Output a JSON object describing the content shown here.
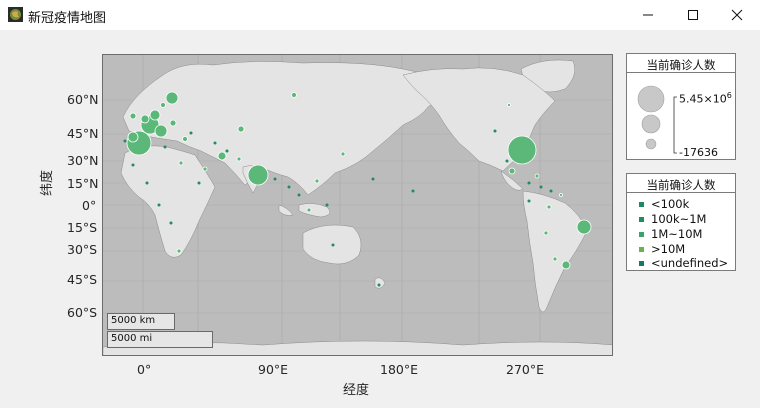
{
  "window": {
    "title": "新冠疫情地图",
    "icon": "globe-icon",
    "controls": [
      "minimize-icon",
      "maximize-icon",
      "close-icon"
    ]
  },
  "axes": {
    "yticks": [
      "60°N",
      "45°N",
      "30°N",
      "15°N",
      "0°",
      "15°S",
      "30°S",
      "45°S",
      "60°S"
    ],
    "xticks": [
      "0°",
      "90°E",
      "180°E",
      "270°E"
    ],
    "xlabel": "经度",
    "ylabel": "纬度"
  },
  "scalebar": {
    "km": "5000 km",
    "mi": "5000 mi"
  },
  "size_legend": {
    "title": "当前确诊人数",
    "max_label": "5.45×10",
    "max_exp": "6",
    "min_label": "-17636"
  },
  "color_legend": {
    "title": "当前确诊人数",
    "items": [
      {
        "label": "<100k",
        "color": "#1d8a63"
      },
      {
        "label": "100k~1M",
        "color": "#1e8e5e"
      },
      {
        "label": "1M~10M",
        "color": "#3aa36a"
      },
      {
        "label": ">10M",
        "color": "#6bb14e"
      },
      {
        "label": "<undefined>",
        "color": "#137a66"
      }
    ]
  },
  "colors": {
    "bubble": "#5bb878",
    "bubble_stroke": "#ffffff",
    "ocean": "#bdbdbd",
    "land": "#e3e3e3"
  }
}
